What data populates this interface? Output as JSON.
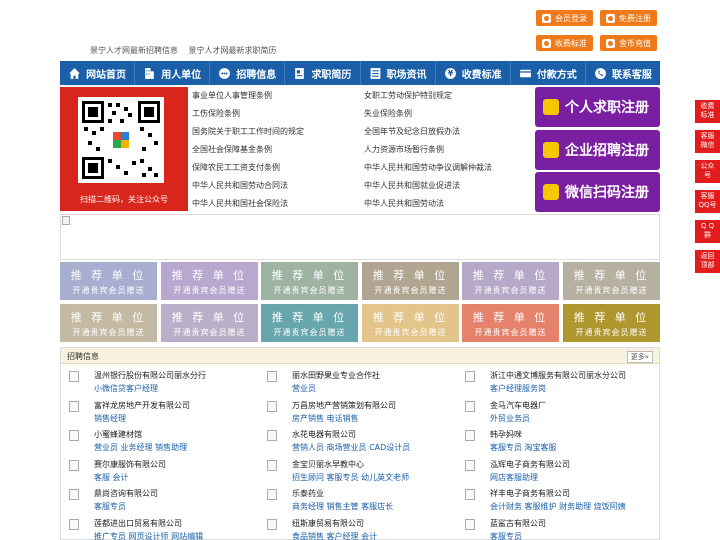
{
  "top_links": [
    "景宁人才网最新招聘信息",
    "景宁人才网最新求职简历"
  ],
  "top_buttons": [
    "会员登录",
    "免费注册",
    "收费标准",
    "金币充值"
  ],
  "nav": [
    {
      "label": "网站首页",
      "icon": "home-icon"
    },
    {
      "label": "用人单位",
      "icon": "building-icon"
    },
    {
      "label": "招聘信息",
      "icon": "chat-icon"
    },
    {
      "label": "求职简历",
      "icon": "resume-icon"
    },
    {
      "label": "职场资讯",
      "icon": "list-icon"
    },
    {
      "label": "收费标准",
      "icon": "coin-icon"
    },
    {
      "label": "付款方式",
      "icon": "payment-icon"
    },
    {
      "label": "联系客服",
      "icon": "phone-icon"
    }
  ],
  "qr_caption": "扫描二维码，关注公众号",
  "laws_left": [
    "事业单位人事管理条例",
    "工伤保险条例",
    "国务院关于职工工作时间的规定",
    "全国社会保障基金条例",
    "保障农民工工资支付条例",
    "中华人民共和国劳动合同法",
    "中华人民共和国社会保险法"
  ],
  "laws_right": [
    "女职工劳动保护特别规定",
    "失业保险条例",
    "全国年节及纪念日放假办法",
    "人力资源市场暂行条例",
    "中华人民共和国劳动争议调解仲裁法",
    "中华人民共和国就业促进法",
    "中华人民共和国劳动法"
  ],
  "register": [
    "个人求职注册",
    "企业招聘注册",
    "微信扫码注册"
  ],
  "rec": {
    "line1": "推 荐 单 位",
    "line2": "开通贵宾会员赠送"
  },
  "rec_colors": [
    "#a7aed0",
    "#b8a7cf",
    "#9fb3a3",
    "#b0a590",
    "#b5a9c7",
    "#b6b0a0",
    "#c4b9a3",
    "#b8b0c8",
    "#68a6ad",
    "#e3c48b",
    "#e5826c",
    "#b0962e"
  ],
  "jobs_title": "招聘信息",
  "more_label": "更多»",
  "jobs": [
    {
      "company": "温州银行股份有限公司丽水分行",
      "positions": "小微信贷客户经理"
    },
    {
      "company": "丽水田野果业专业合作社",
      "positions": "营业员"
    },
    {
      "company": "浙江中通文博服务有限公司丽水分公司",
      "positions": "客户经理服务岗"
    },
    {
      "company": "富祥龙房地产开发有限公司",
      "positions": "销售经理"
    },
    {
      "company": "万昌房地产营销策划有限公司",
      "positions": "房产销售 电话销售"
    },
    {
      "company": "金马汽车电器厂",
      "positions": "外贸业务员"
    },
    {
      "company": "小蜜蜂建材馆",
      "positions": "营业员 业务经理 销售助理"
    },
    {
      "company": "水花电器有限公司",
      "positions": "营销人员 商场营业员 CAD设计员"
    },
    {
      "company": "韩孕妈咪",
      "positions": "客服专员 淘宝客服"
    },
    {
      "company": "赛尔康服饰有限公司",
      "positions": "客服 会计"
    },
    {
      "company": "金宝贝丽水早教中心",
      "positions": "招生顾问 客服专员 幼儿英文老师"
    },
    {
      "company": "泓辉电子商务有限公司",
      "positions": "网店客服助理"
    },
    {
      "company": "鼎尚咨询有限公司",
      "positions": "客服专员"
    },
    {
      "company": "乐泰药业",
      "positions": "商务经理 销售主管 客服店长"
    },
    {
      "company": "祥丰电子商务有限公司",
      "positions": "会计财务 客服维护 财务助理 烧饭阿姨"
    },
    {
      "company": "莲都进出口贸易有限公司",
      "positions": "推广专员 网页设计师 网站编辑"
    },
    {
      "company": "纽斯康贸易有限公司",
      "positions": "食品销售 客户经理 会计"
    },
    {
      "company": "蓝鲨古有限公司",
      "positions": "客服专员"
    }
  ],
  "float_menu": [
    "收费\n标准",
    "客服\n微信",
    "公众\n号",
    "客服\nQQ号",
    "Q Q\n群",
    "返回\n顶部"
  ],
  "colors": {
    "nav": "#1a5fa8",
    "orange": "#f07a1a",
    "purple": "#7a1fa2",
    "red": "#e21c1c"
  }
}
